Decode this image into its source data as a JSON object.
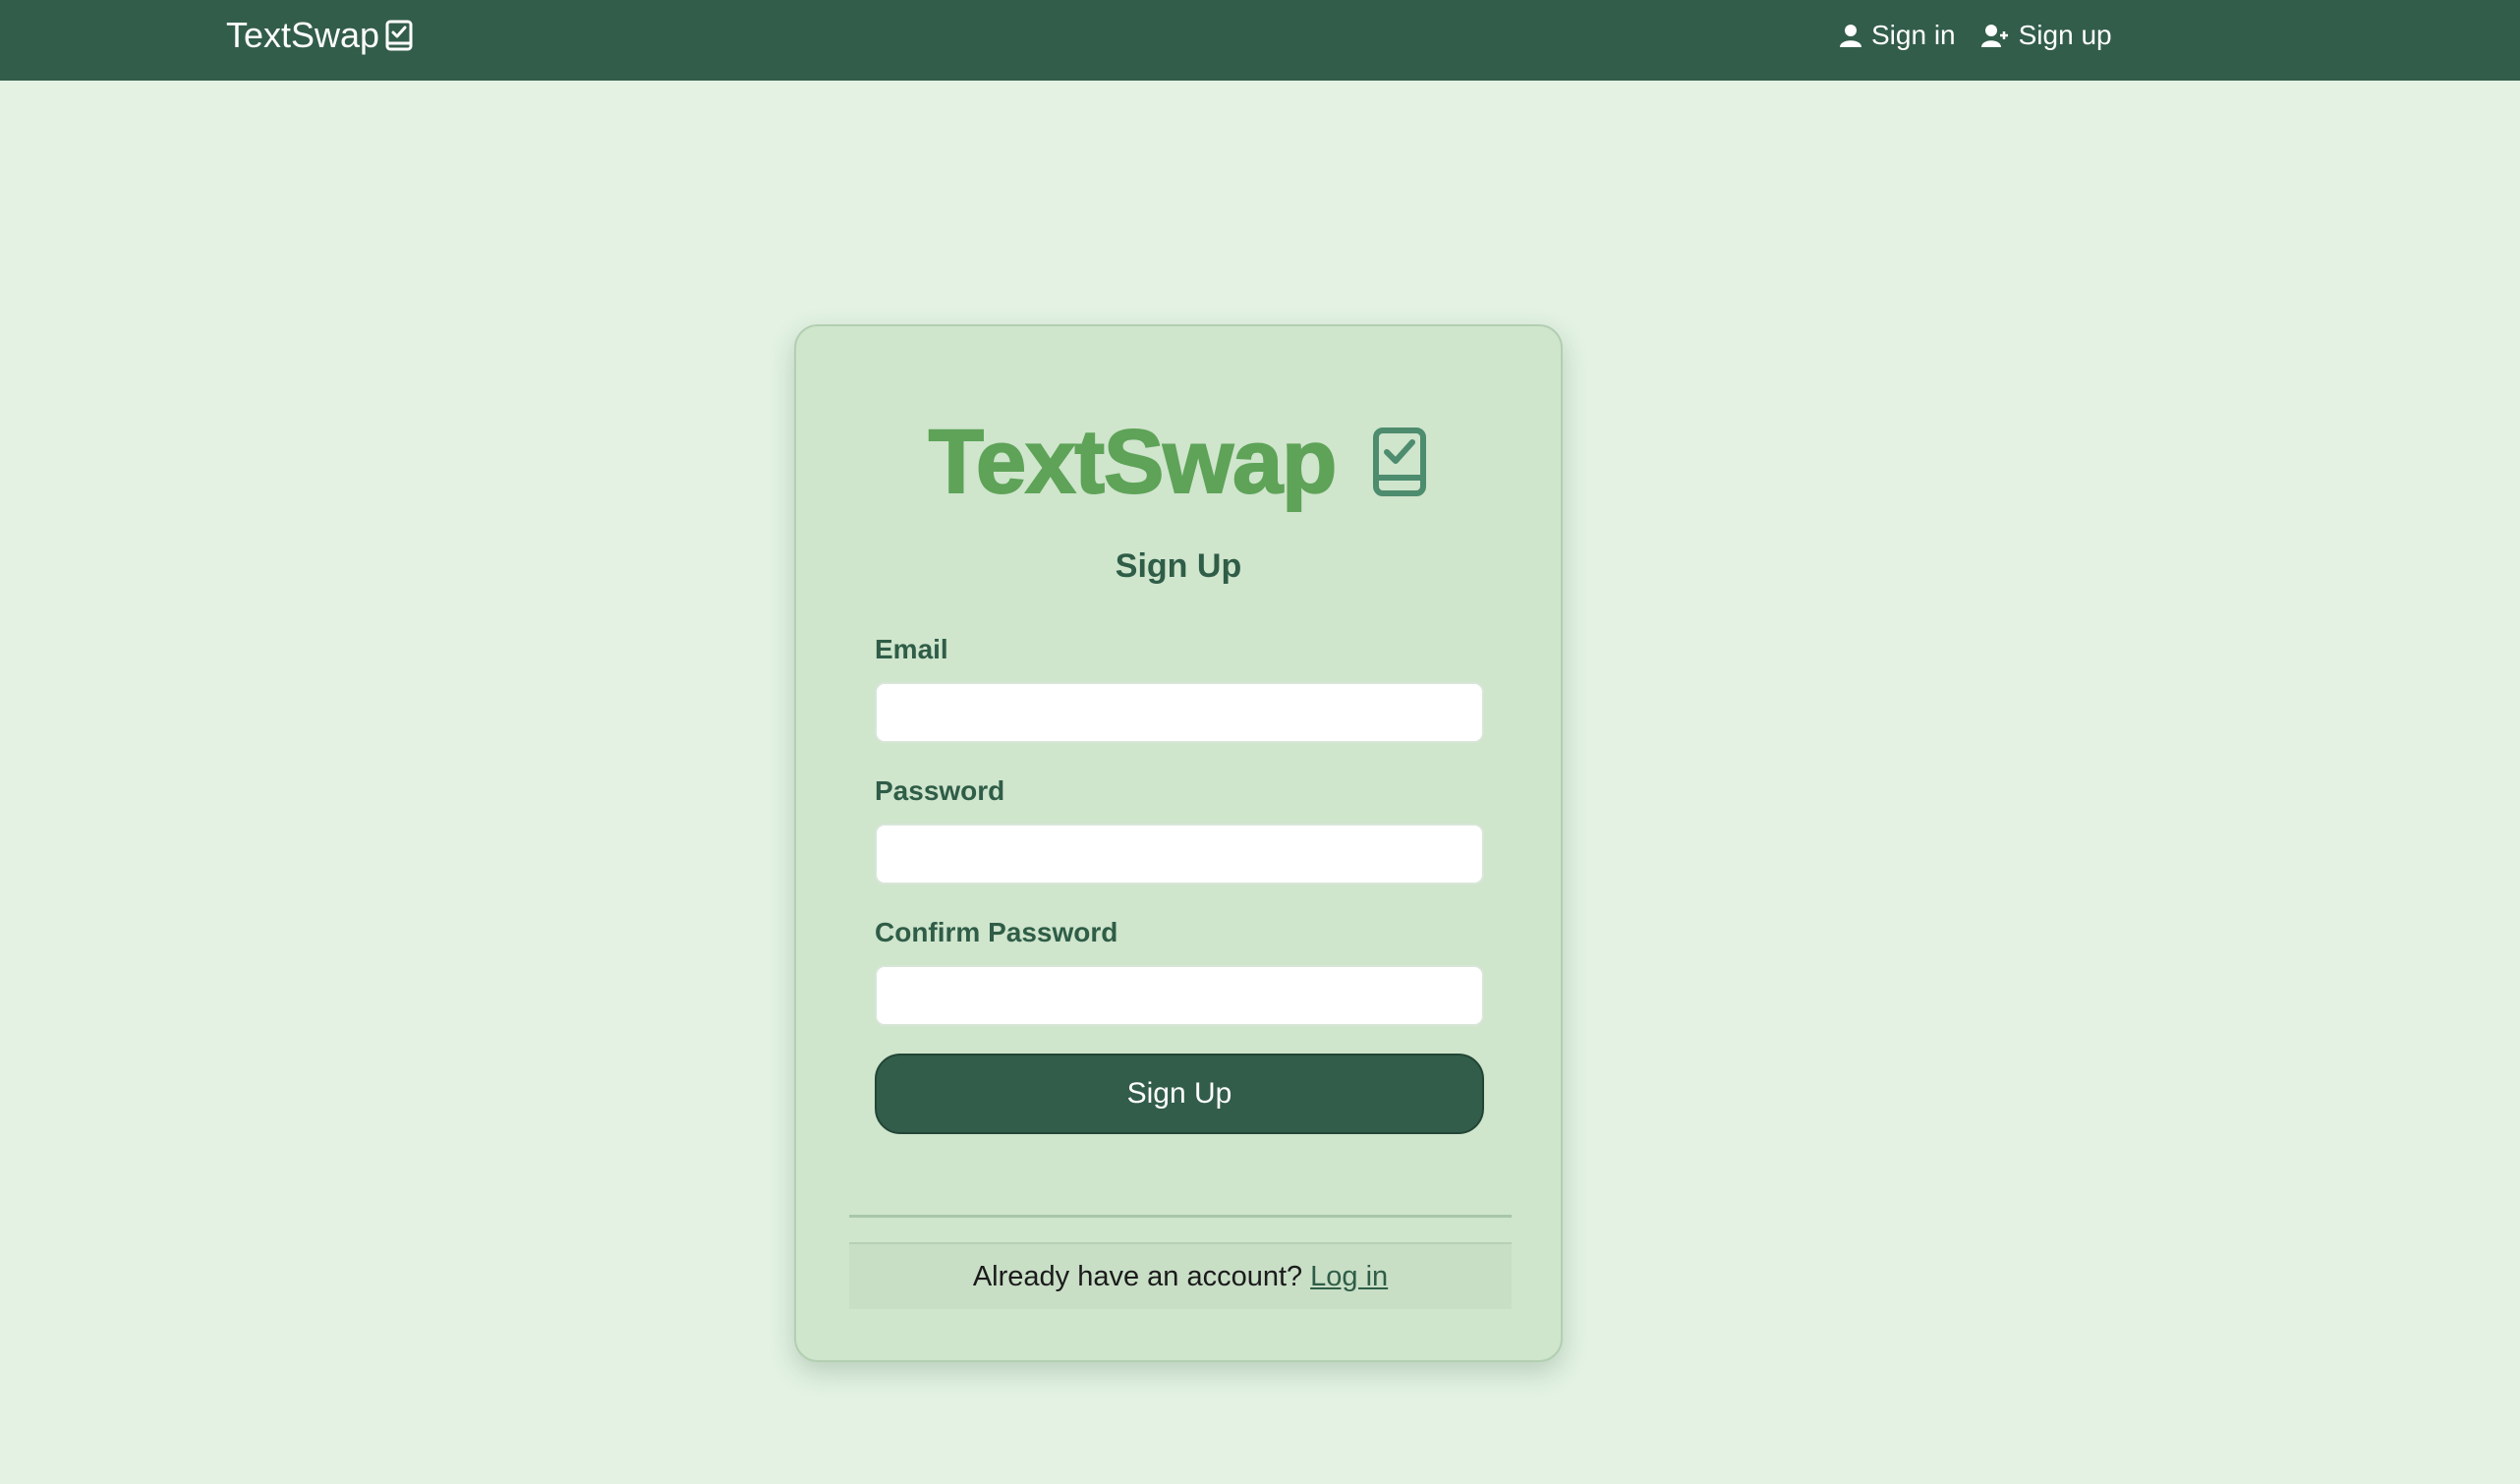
{
  "navbar": {
    "brand": "TextSwap",
    "brand_icon": "book-check-icon",
    "links": [
      {
        "label": "Sign in",
        "icon": "user-icon"
      },
      {
        "label": "Sign up",
        "icon": "user-plus-icon"
      }
    ]
  },
  "card": {
    "logo_text": "TextSwap",
    "logo_icon": "book-check-icon",
    "title": "Sign Up",
    "fields": {
      "email": {
        "label": "Email",
        "value": "",
        "placeholder": ""
      },
      "password": {
        "label": "Password",
        "value": "",
        "placeholder": ""
      },
      "confirm_password": {
        "label": "Confirm Password",
        "value": "",
        "placeholder": ""
      }
    },
    "submit_label": "Sign Up",
    "footer": {
      "prompt": "Already have an account?",
      "link_label": "Log in"
    }
  },
  "colors": {
    "page_background": "#e3f2e3",
    "navbar_background": "#325d4a",
    "card_background": "#cfe5cc",
    "logo_green": "#5ea358",
    "text_dark_green": "#2f5d47"
  }
}
